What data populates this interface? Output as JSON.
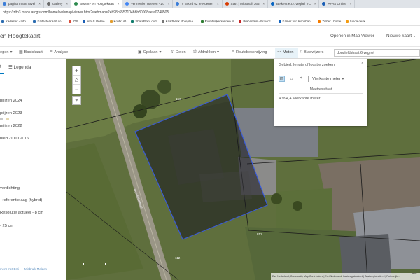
{
  "browser": {
    "tabs": [
      {
        "label": "pagina InSite Arvel",
        "color": "#3b7dd8"
      },
      {
        "label": "Gallery",
        "color": "#6b6b6b"
      },
      {
        "label": "Bodem- en Hoogtekaart",
        "color": "#2d8a4e",
        "active": true
      },
      {
        "label": "vermeulen nuenen - Zo",
        "color": "#4285f4"
      },
      {
        "label": "V Boord 62 te Nuenen",
        "color": "#3b7dd8"
      },
      {
        "label": "Start | Microsoft 365",
        "color": "#d83b01"
      },
      {
        "label": "Beikers K.IJ. Veghel VC",
        "color": "#0a66c2"
      },
      {
        "label": "AFAS Online",
        "color": "#1b5fb6"
      }
    ],
    "url": "https://zlto3.maps.arcgis.com/home/webmap/viewer.html?webmap=2eb98c6557104bbb80008aefa0748505",
    "bookmarks": [
      {
        "label": "Kadaster - Info...",
        "color": "#2b6cb0"
      },
      {
        "label": "KadasterKaart.co...",
        "color": "#2b6cb0"
      },
      {
        "label": "IDS",
        "color": "#d94f3d"
      },
      {
        "label": "AFAS Online",
        "color": "#1b5fb6"
      },
      {
        "label": "Kolibri iO",
        "color": "#e29c2b"
      },
      {
        "label": "SharePoint oud",
        "color": "#0f7b6c"
      },
      {
        "label": "Kaartbank storeplea...",
        "color": "#777"
      },
      {
        "label": "Ruimtelijkeplannen.nl",
        "color": "#2e7d32"
      },
      {
        "label": "Brabantsin - Provinc...",
        "color": "#c62828"
      },
      {
        "label": "Kamer van Koophan...",
        "color": "#1565c0"
      },
      {
        "label": "Zibber | home",
        "color": "#f57c00"
      },
      {
        "label": "funda desk",
        "color": "#f39c12"
      }
    ]
  },
  "app": {
    "title": "en Hoogtekaart",
    "open_map_viewer": "Openen in Map Viewer",
    "new_map": "Nieuwe kaart",
    "new_map_chevron": "⌄"
  },
  "toolbar": {
    "left_partial": "egen",
    "basemap": "Basiskaart",
    "analysis": "Analyse",
    "save": "Opslaan",
    "share": "Delen",
    "print": "Afdrukken",
    "directions": "Routebeschrijving",
    "measure": "Meten",
    "bookmarks": "Bladwijzers",
    "search_value": "dondieldstraat 6 veghel"
  },
  "panel": {
    "tab_details": "t",
    "tab_legend": "Legenda",
    "layers": [
      "prijzen 2024",
      "prijzen 2023",
      "prijzen 2022",
      "bied ZLTO 2016",
      "verdichting",
      "- referentielaag (hybrid)",
      "Resolutie actueel - 8 cm",
      "- 25 cm"
    ],
    "footer_left": "ment met Esri",
    "footer_right": "Misbruik Melden"
  },
  "map": {
    "zoom_in": "+",
    "home": "⌂",
    "zoom_out": "−",
    "locate": "⌖",
    "parcel_numbers": [
      "153",
      "812",
      "112"
    ],
    "street_label": "Dondieldstraat",
    "attribution": "Esri Nederland, Community Map Contributors | Esri Nederland, basisregistratie.nl | Basisregistratie.nl | Ruimtelijk...",
    "esri_logo": "esri"
  },
  "measure": {
    "hint": "Gebied, lengte of locatie zoeken",
    "unit_label": "Vierkante meter",
    "result_label": "Meetresultaat",
    "result_value": "4.994,4 Vierkante meter",
    "close": "×",
    "collapse": "^"
  },
  "colors": {
    "accent": "#0079c1",
    "polygon_stroke": "#3a5bd8",
    "polygon_fill": "rgba(20,20,30,0.55)"
  }
}
